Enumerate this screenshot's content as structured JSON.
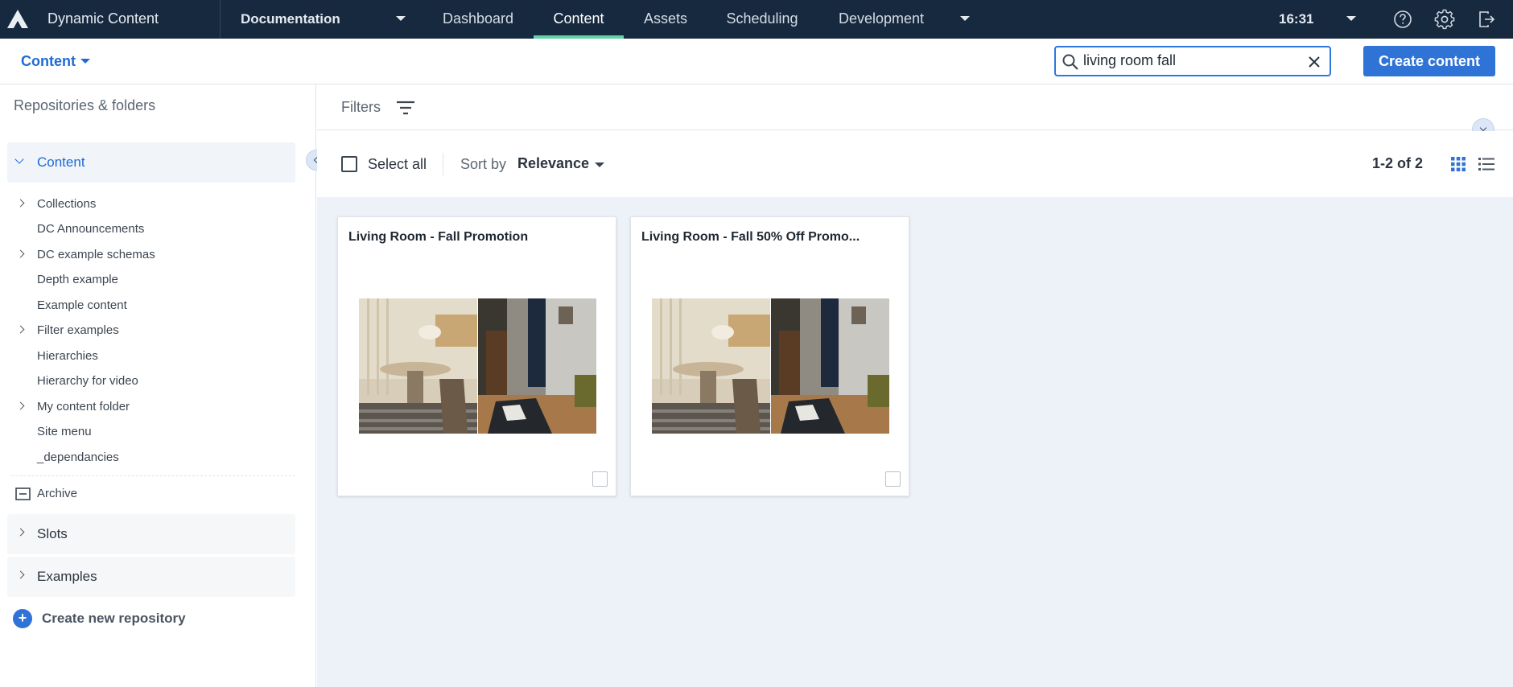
{
  "app": {
    "brand": "Dynamic Content",
    "hub": "Documentation",
    "time": "16:31"
  },
  "nav": {
    "tabs": [
      {
        "label": "Dashboard"
      },
      {
        "label": "Content"
      },
      {
        "label": "Assets"
      },
      {
        "label": "Scheduling"
      },
      {
        "label": "Development"
      }
    ],
    "active": "Content"
  },
  "subheader": {
    "section": "Content",
    "create_label": "Create content"
  },
  "search": {
    "value": "living room fall"
  },
  "sidebar": {
    "heading": "Repositories & folders",
    "root": "Content",
    "items": [
      {
        "label": "Collections",
        "expandable": true
      },
      {
        "label": "DC Announcements",
        "expandable": false
      },
      {
        "label": "DC example schemas",
        "expandable": true
      },
      {
        "label": "Depth example",
        "expandable": false
      },
      {
        "label": "Example content",
        "expandable": false
      },
      {
        "label": "Filter examples",
        "expandable": true
      },
      {
        "label": "Hierarchies",
        "expandable": false
      },
      {
        "label": "Hierarchy for video",
        "expandable": false
      },
      {
        "label": "My content folder",
        "expandable": true
      },
      {
        "label": "Site menu",
        "expandable": false
      },
      {
        "label": "_dependancies",
        "expandable": false
      }
    ],
    "archive": "Archive",
    "repositories": [
      {
        "label": "Slots"
      },
      {
        "label": "Examples"
      }
    ],
    "create_repo": "Create new repository"
  },
  "filters": {
    "label": "Filters"
  },
  "toolbar": {
    "select_all": "Select all",
    "sort_label": "Sort by",
    "sort_value": "Relevance",
    "count": "1-2 of 2"
  },
  "cards": [
    {
      "title": "Living Room - Fall Promotion"
    },
    {
      "title": "Living Room - Fall 50% Off Promo..."
    }
  ],
  "colors": {
    "topbar": "#17293f",
    "accent": "#2f73d6",
    "active_tab": "#5fd3a6",
    "content_bg": "#edf1f8"
  }
}
